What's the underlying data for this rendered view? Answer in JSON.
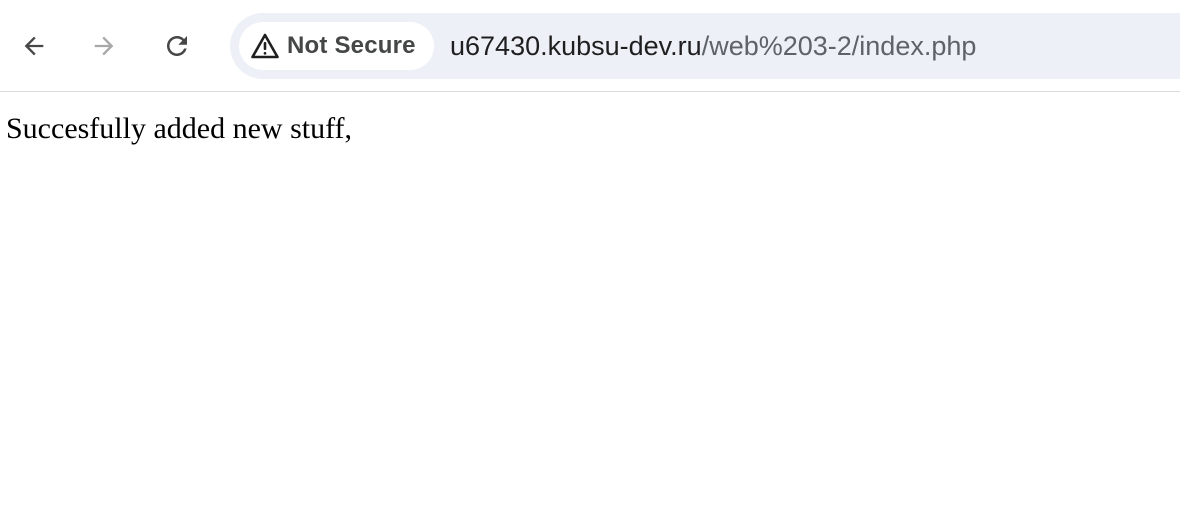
{
  "browser": {
    "toolbar": {
      "back_icon": "arrow-left-icon",
      "forward_icon": "arrow-right-icon",
      "reload_icon": "reload-icon"
    },
    "address_bar": {
      "security_icon": "warning-triangle-icon",
      "security_label": "Not Secure",
      "url_host": "u67430.kubsu-dev.ru",
      "url_path": "/web%203-2/index.php",
      "background_color": "#edf0f7"
    }
  },
  "page": {
    "message": "Succesfully added new stuff,"
  }
}
